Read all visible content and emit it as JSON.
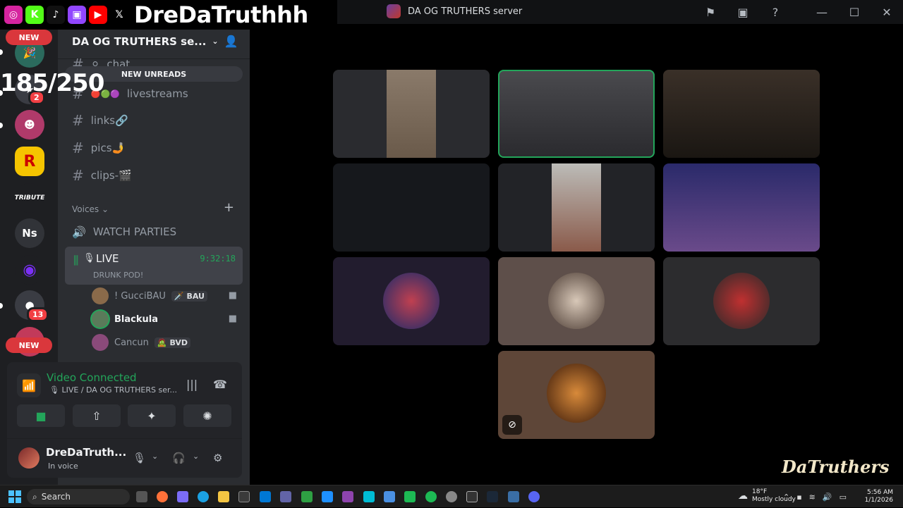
{
  "overlay": {
    "handle": "DreDaTruthhh",
    "counter": "185/250",
    "socials": [
      {
        "icon": "instagram-icon",
        "glyph": "◎",
        "color": "#d6249f"
      },
      {
        "icon": "kick-icon",
        "glyph": "K",
        "color": "#53fc18"
      },
      {
        "icon": "tiktok-icon",
        "glyph": "♪",
        "color": "#111111"
      },
      {
        "icon": "twitch-icon",
        "glyph": "▣",
        "color": "#9146ff"
      },
      {
        "icon": "youtube-icon",
        "glyph": "▶",
        "color": "#ff0000"
      },
      {
        "icon": "x-icon",
        "glyph": "𝕏",
        "color": "#000000"
      }
    ]
  },
  "window": {
    "title": "DA OG TRUTHERS server"
  },
  "rail": {
    "new_top": "NEW",
    "new_bottom": "NEW",
    "badges": {
      "first": "2",
      "second": "13"
    },
    "guild_ns": "Ns",
    "guild_tribute": "TRIBUTE",
    "guild_r": "R"
  },
  "sidebar": {
    "server_name": "DA OG TRUTHERS se...",
    "new_unreads": "NEW UNREADS",
    "channels": [
      {
        "name": "chat",
        "prefix": "⚪"
      },
      {
        "name": "livestreams",
        "prefix": "🔴🟢🟣"
      },
      {
        "name": "links🔗",
        "prefix": ""
      },
      {
        "name": "pics🤳",
        "prefix": ""
      },
      {
        "name": "clips-🎬",
        "prefix": ""
      }
    ],
    "category": "Voices",
    "watch_parties": "WATCH PARTIES",
    "live_channel": {
      "name": "LIVE",
      "time": "9:32:18",
      "subtitle": "DRUNK POD!"
    },
    "members": [
      {
        "name": "! GucciBAU",
        "tag": "BAU",
        "tag_icon": "🗡️"
      },
      {
        "name": "Blackula",
        "tag": "",
        "tag_icon": ""
      },
      {
        "name": "Cancun",
        "tag": "BVD",
        "tag_icon": "🧟"
      }
    ]
  },
  "voice_panel": {
    "status": "Video Connected",
    "location": "LIVE / DA OG TRUTHERS ser..."
  },
  "user_panel": {
    "name": "DreDaTruth...",
    "status": "In voice"
  },
  "watermark": "DaTruthers",
  "taskbar": {
    "search": "Search",
    "weather_temp": "18°F",
    "weather_desc": "Mostly cloudy",
    "time": "5:56 AM",
    "date": "1/1/2026"
  }
}
